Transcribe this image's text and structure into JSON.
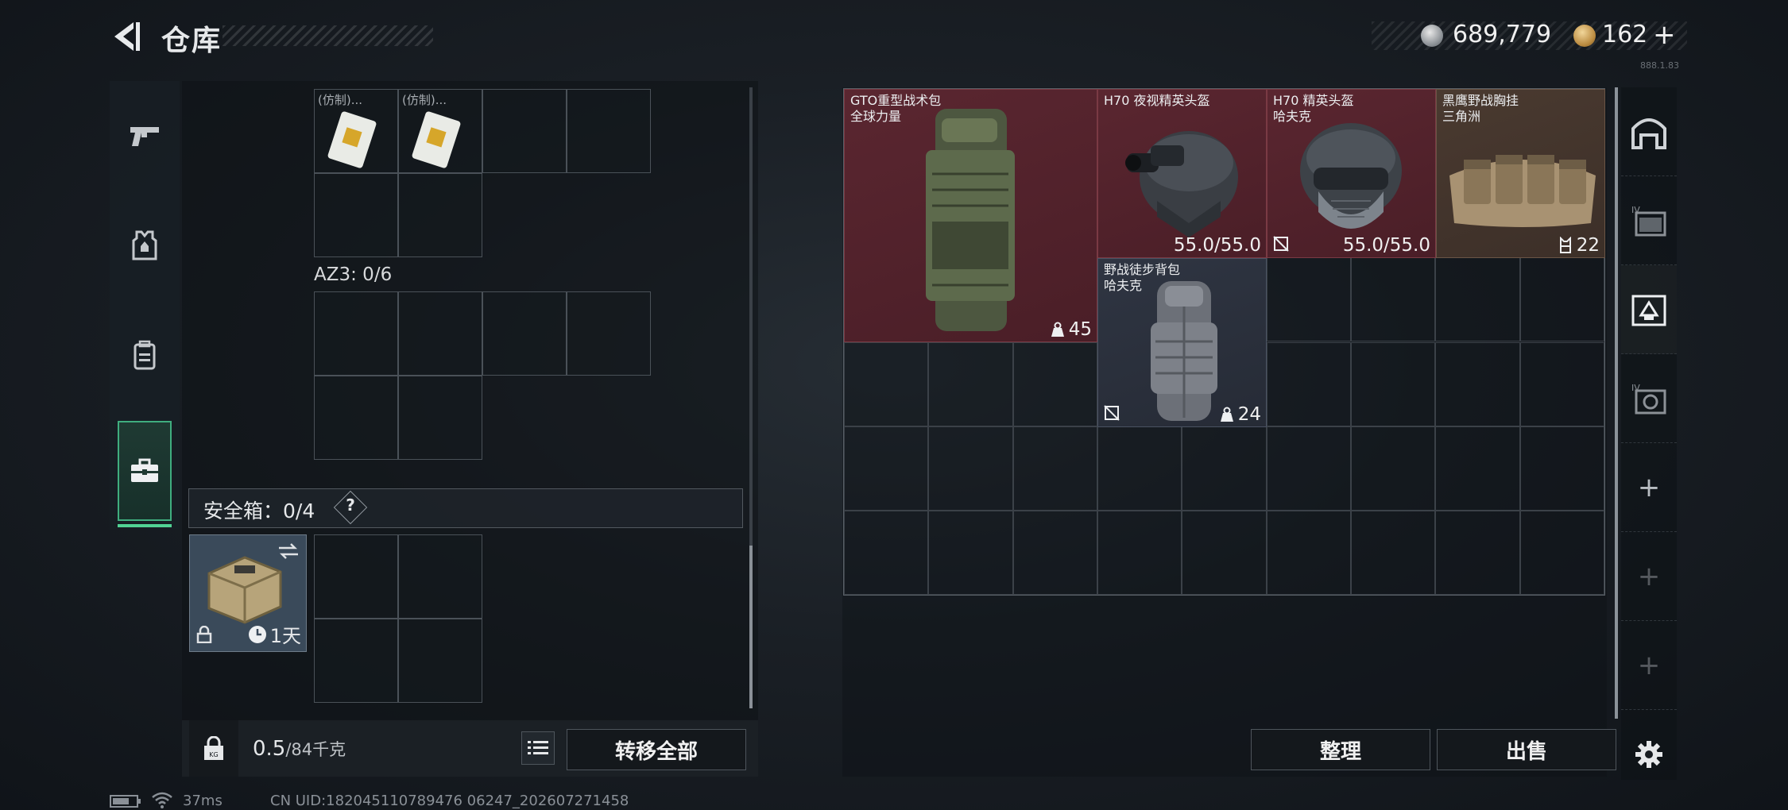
{
  "header": {
    "title": "仓库",
    "silver_amount": "689,779",
    "gold_amount": "162",
    "gold_add": "+",
    "version_tag": "888.1.83"
  },
  "left_nav": {
    "items": [
      {
        "icon": "pistol-icon"
      },
      {
        "icon": "armor-icon"
      },
      {
        "icon": "backpack-icon"
      },
      {
        "icon": "toolbox-icon",
        "active": true
      }
    ]
  },
  "left_panel": {
    "top_items": [
      "(仿制)...",
      "(仿制)..."
    ],
    "az3_label": "AZ3: 0/6",
    "safebox_label": "安全箱：0/4",
    "safebox_help": "?",
    "case_time": "1天",
    "weight_value": "0.5",
    "weight_max": "/84千克",
    "transfer_all": "转移全部"
  },
  "stash_items": [
    {
      "name": "GTO重型战术包\n全球力量",
      "stat": "45",
      "stat_icon": "weight-icon"
    },
    {
      "name": "H70 夜视精英头盔",
      "stat": "55.0/55.0"
    },
    {
      "name": "H70 精英头盔\n哈夫克",
      "stat": "55.0/55.0",
      "corner_icon": "no-repair-icon"
    },
    {
      "name": "黑鹰野战胸挂\n三角洲",
      "stat": "22",
      "stat_icon": "vest-icon"
    },
    {
      "name": "野战徒步背包\n哈夫克",
      "stat": "24",
      "stat_icon": "weight-icon",
      "corner_icon": "no-repair-icon"
    }
  ],
  "right_footer": {
    "organize": "整理",
    "sell": "出售"
  },
  "status_bar": {
    "ping": "37ms",
    "uid": "CN UID:182045110789476 06247_202607271458"
  },
  "colors": {
    "accent_green": "#51d394",
    "item_red": "#5a2630",
    "item_blue": "#2f3542",
    "item_brown": "#4a3a30"
  }
}
